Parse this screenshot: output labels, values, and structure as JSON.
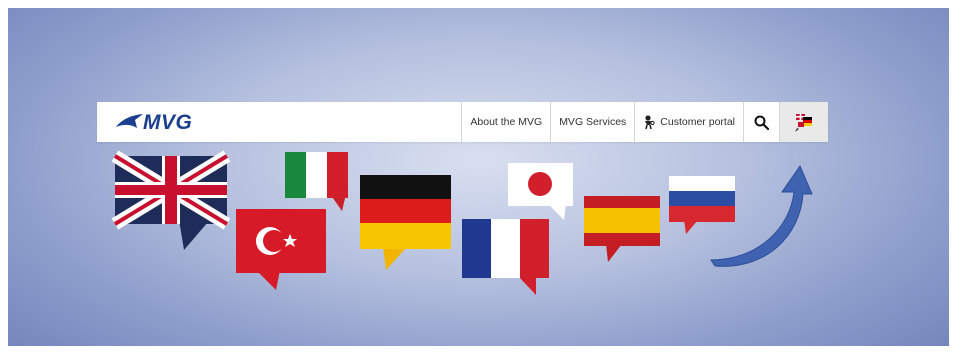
{
  "header": {
    "logo_text": "MVG",
    "nav": {
      "about_label": "About the MVG",
      "services_label": "MVG Services",
      "portal_label": "Customer portal"
    }
  },
  "icons": {
    "portal": "person-key-icon",
    "search": "search-icon",
    "language": "language-flags-icon"
  },
  "flags": [
    "united-kingdom",
    "turkey",
    "italy",
    "germany",
    "japan",
    "france",
    "spain",
    "russia"
  ],
  "colors": {
    "brand": "#1a3f8f",
    "arrow": "#3f63b0"
  }
}
